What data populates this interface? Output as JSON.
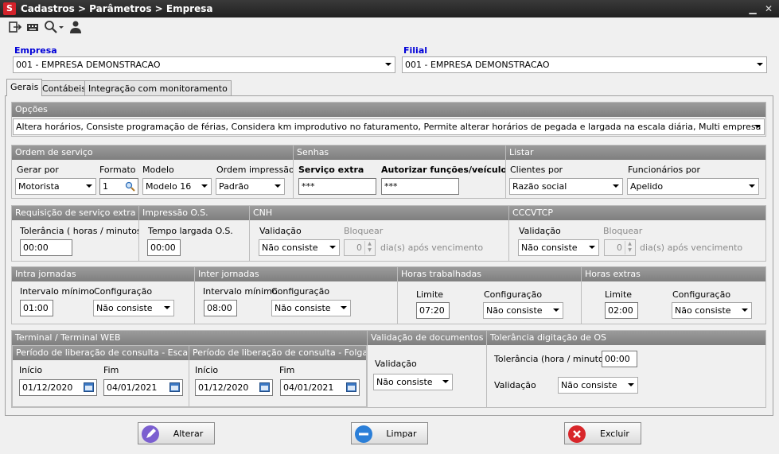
{
  "window": {
    "title": "Cadastros > Parâmetros > Empresa",
    "app_icon_letter": "S"
  },
  "toolbar": {
    "icons": [
      "exit-icon",
      "keyboard-icon",
      "search-icon",
      "user-icon"
    ]
  },
  "empresa": {
    "label": "Empresa",
    "value": "001 - EMPRESA DEMONSTRACAO"
  },
  "filial": {
    "label": "Filial",
    "value": "001 - EMPRESA DEMONSTRACAO"
  },
  "tabs": [
    "Gerais",
    "Contábeis",
    "Integração com monitoramento"
  ],
  "opcoes": {
    "title": "Opções",
    "value": "Altera horários, Consiste programação de férias, Considera km improdutivo no faturamento, Permite alterar horários de pegada e largada na escala diária, Multi empresa e filial para funcionári..."
  },
  "ordem": {
    "title": "Ordem de serviço",
    "gerar_label": "Gerar por",
    "gerar_value": "Motorista",
    "formato_label": "Formato",
    "formato_value": "1",
    "modelo_label": "Modelo",
    "modelo_value": "Modelo 16",
    "impressao_label": "Ordem impressão",
    "impressao_value": "Padrão"
  },
  "senhas": {
    "title": "Senhas",
    "extra_label": "Serviço extra",
    "extra_value": "***",
    "autorizar_label": "Autorizar funções/veículos",
    "autorizar_value": "***"
  },
  "listar": {
    "title": "Listar",
    "clientes_label": "Clientes por",
    "clientes_value": "Razão social",
    "func_label": "Funcionários por",
    "func_value": "Apelido"
  },
  "requisicao": {
    "title": "Requisição de serviço extra",
    "label": "Tolerância ( horas / minutos )",
    "value": "00:00"
  },
  "impressao_os": {
    "title": "Impressão O.S.",
    "label": "Tempo largada O.S.",
    "value": "00:00"
  },
  "cnh": {
    "title": "CNH",
    "validacao_label": "Validação",
    "validacao_value": "Não consiste",
    "bloquear_label": "Bloquear",
    "bloquear_value": "0",
    "suffix": "dia(s) após vencimento"
  },
  "cccvtcp": {
    "title": "CCCVTCP",
    "validacao_label": "Validação",
    "validacao_value": "Não consiste",
    "bloquear_label": "Bloquear",
    "bloquear_value": "0",
    "suffix": "dia(s) após vencimento"
  },
  "intra": {
    "title": "Intra jornadas",
    "intervalo_label": "Intervalo mínimo",
    "intervalo_value": "01:00",
    "config_label": "Configuração",
    "config_value": "Não consiste"
  },
  "inter": {
    "title": "Inter jornadas",
    "intervalo_label": "Intervalo mínimo",
    "intervalo_value": "08:00",
    "config_label": "Configuração",
    "config_value": "Não consiste"
  },
  "horas_trab": {
    "title": "Horas trabalhadas",
    "limite_label": "Limite",
    "limite_value": "07:20",
    "config_label": "Configuração",
    "config_value": "Não consiste"
  },
  "horas_extras": {
    "title": "Horas extras",
    "limite_label": "Limite",
    "limite_value": "02:00",
    "config_label": "Configuração",
    "config_value": "Não consiste"
  },
  "terminal": {
    "title": "Terminal / Terminal WEB",
    "escala": {
      "title": "Período de liberação de consulta - Escala",
      "inicio_label": "Início",
      "inicio_value": "01/12/2020",
      "fim_label": "Fim",
      "fim_value": "04/01/2021"
    },
    "folgas": {
      "title": "Período de liberação de consulta - Folgas",
      "inicio_label": "Início",
      "inicio_value": "01/12/2020",
      "fim_label": "Fim",
      "fim_value": "04/01/2021"
    }
  },
  "valid_docs": {
    "title": "Validação de documentos do",
    "label": "Validação",
    "value": "Não consiste"
  },
  "tol_os": {
    "title": "Tolerância digitação de OS",
    "tol_label": "Tolerância (hora / minutos)",
    "tol_value": "00:00",
    "valid_label": "Validação",
    "valid_value": "Não consiste"
  },
  "buttons": {
    "alterar": "Alterar",
    "limpar": "Limpar",
    "excluir": "Excluir"
  },
  "colors": {
    "title_bar": "#2a2a2a",
    "group_header": "#8c8c8c",
    "label_blue": "#0000d8",
    "alterar_icon": "#7b5fd0",
    "limpar_icon": "#2b7fd8",
    "excluir_icon": "#d8262a"
  }
}
